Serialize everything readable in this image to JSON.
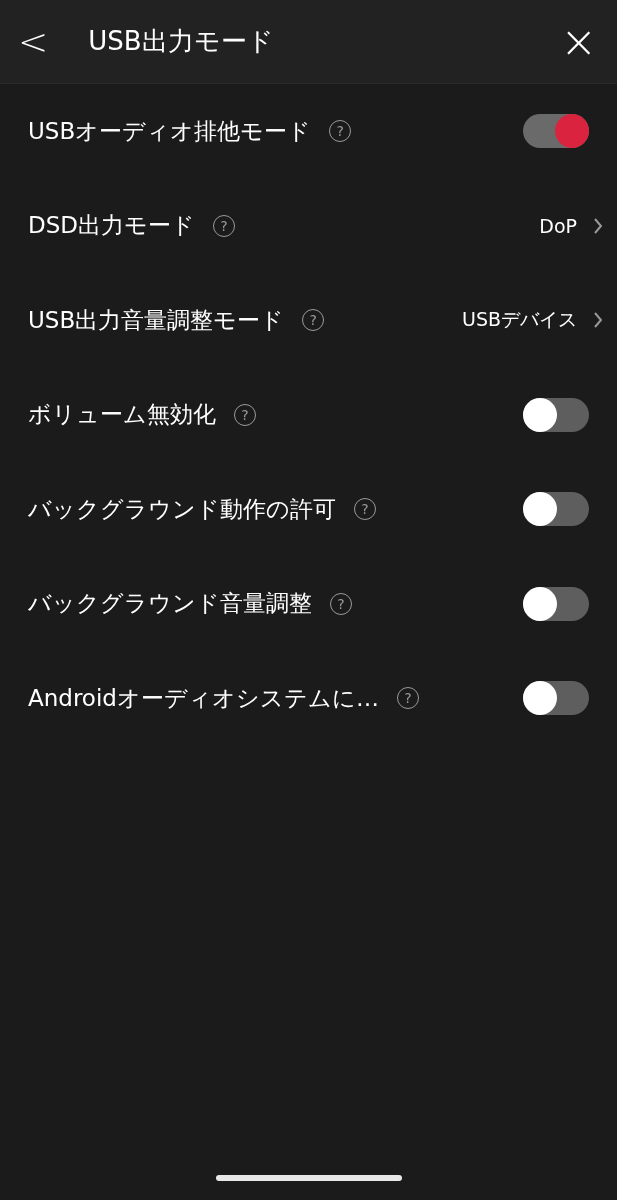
{
  "header": {
    "back": "<",
    "title": "USB出力モード",
    "close": "×"
  },
  "settings": [
    {
      "kind": "toggle",
      "label": "USBオーディオ排他モード",
      "help": "?",
      "on": true
    },
    {
      "kind": "select",
      "label": "DSD出力モード",
      "help": "?",
      "value": "DoP"
    },
    {
      "kind": "select",
      "label": "USB出力音量調整モード",
      "help": "?",
      "value": "USBデバイス"
    },
    {
      "kind": "toggle",
      "label": "ボリューム無効化",
      "help": "?",
      "on": false
    },
    {
      "kind": "toggle",
      "label": "バックグラウンド動作の許可",
      "help": "?",
      "on": false
    },
    {
      "kind": "toggle",
      "label": "バックグラウンド音量調整",
      "help": "?",
      "on": false
    },
    {
      "kind": "toggle",
      "label": "Androidオーディオシステムに…",
      "help": "?",
      "on": false
    }
  ]
}
